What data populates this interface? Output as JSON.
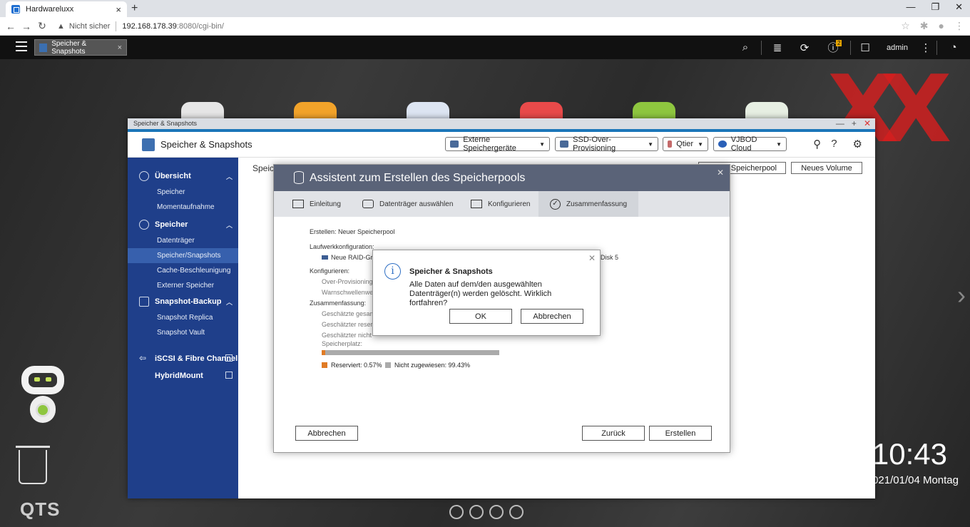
{
  "browser": {
    "tab_title": "Hardwareluxx",
    "tab_close": "×",
    "new_tab": "+",
    "controls": {
      "minimize": "—",
      "maximize": "❐",
      "close": "✕"
    },
    "security_label": "Nicht sicher",
    "url_host": "192.168.178.39",
    "url_rest": ":8080/cgi-bin/"
  },
  "qts_bar": {
    "app_tab_label": "Speicher & Snapshots",
    "notification_count": "2",
    "user": "admin"
  },
  "desktop": {
    "clock": "10:43",
    "date": "021/01/04 Montag",
    "brand": "QTS",
    "watermark": "XX"
  },
  "window": {
    "titlebar": "Speicher & Snapshots",
    "app_title": "Speicher & Snapshots",
    "toolbar": [
      {
        "label": "Externe Speichergeräte"
      },
      {
        "label": "SSD-Over-Provisioning"
      },
      {
        "label": "Qtier"
      },
      {
        "label": "VJBOD Cloud"
      }
    ],
    "main_title": "Speic",
    "btn_pool": "Speicherpool",
    "btn_volume": "Neues Volume"
  },
  "sidebar": {
    "sections": [
      {
        "label": "Übersicht",
        "items": [
          "Speicher",
          "Momentaufnahme"
        ]
      },
      {
        "label": "Speicher",
        "items": [
          "Datenträger",
          "Speicher/Snapshots",
          "Cache-Beschleunigung",
          "Externer Speicher"
        ]
      },
      {
        "label": "Snapshot-Backup",
        "items": [
          "Snapshot Replica",
          "Snapshot Vault"
        ]
      }
    ],
    "links": [
      "iSCSI & Fibre Channel",
      "HybridMount"
    ]
  },
  "wizard": {
    "title": "Assistent zum Erstellen des Speicherpools",
    "steps": [
      "Einleitung",
      "Datenträger auswählen",
      "Konfigurieren",
      "Zusammenfassung"
    ],
    "create_line": "Erstellen: Neuer Speicherpool",
    "drive_config_label": "Laufwerkkonfiguration:",
    "raid_group": "Neue RAID-Grupp",
    "disk_label": "Disk 5",
    "configure_label": "Konfigurieren:",
    "over_prov": "Over-Provisioning:",
    "warn_threshold": "Warnschwellenwer",
    "summary_label": "Zusammenfassung:",
    "est_total": "Geschätzte gesam",
    "est_reserved": "Geschätzter reserv",
    "est_unassigned": "Geschätzter nicht",
    "storage_space": "Speicherplatz:",
    "reserved_fraction": 0.0057,
    "legend_reserved": "Reserviert: 0.57%",
    "legend_unassigned": "Nicht zugewiesen: 99.43%",
    "reserved_color": "#e07b25",
    "unassigned_color": "#aaaaaa",
    "btn_cancel": "Abbrechen",
    "btn_back": "Zurück",
    "btn_create": "Erstellen"
  },
  "confirm": {
    "icon": "i",
    "title": "Speicher & Snapshots",
    "message": "Alle Daten auf dem/den ausgewählten Datenträger(n) werden gelöscht. Wirklich fortfahren?",
    "ok": "OK",
    "cancel": "Abbrechen"
  }
}
